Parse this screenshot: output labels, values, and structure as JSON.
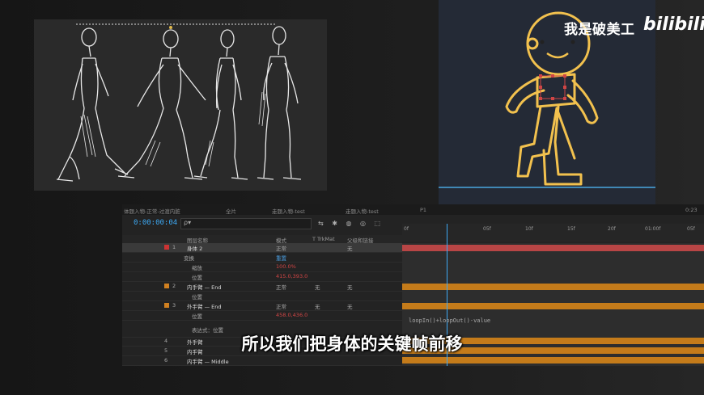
{
  "watermark": {
    "author": "我是破美工",
    "brand": "bilibili"
  },
  "subtitle": "所以我们把身体的关键帧前移",
  "ae": {
    "tabs": [
      "体题入物-正常-过渡内脏",
      "全片",
      "走题入物-test",
      "走题入物-test",
      "P1",
      "0:23"
    ],
    "timecode": "0:00:00:04",
    "search_placeholder": "ρ▾",
    "tools": "⇆ ✱ ◍ ◎ ⬚",
    "col_headers": [
      "图层名称",
      "模式",
      "T TrkMat",
      "父级和链接"
    ],
    "rows": [
      {
        "num": "1",
        "name": "身体 2",
        "mode": "正常",
        "parent": "无"
      },
      {
        "num": "",
        "name": "变换",
        "mode": "重置",
        "parent": ""
      },
      {
        "num": "",
        "name": "缩放",
        "mode": "100.0%",
        "parent": ""
      },
      {
        "num": "",
        "name": "位置",
        "mode": "415.0,393.0",
        "parent": ""
      },
      {
        "num": "2",
        "name": "内手臂 — End",
        "mode": "正常",
        "trkmat": "无",
        "parent": "无"
      },
      {
        "num": "",
        "name": "位置",
        "mode": "",
        "parent": ""
      },
      {
        "num": "3",
        "name": "外手臂 — End",
        "mode": "正常",
        "trkmat": "无",
        "parent": "无"
      },
      {
        "num": "",
        "name": "位置",
        "mode": "458.0,436.0",
        "parent": ""
      },
      {
        "num": "",
        "name": "表达式：位置",
        "mode": "",
        "parent": ""
      },
      {
        "num": "4",
        "name": "外手臂",
        "mode": "",
        "parent": ""
      },
      {
        "num": "5",
        "name": "内手臂",
        "mode": "",
        "parent": ""
      },
      {
        "num": "6",
        "name": "内手臂 — Middle",
        "mode": "",
        "parent": ""
      },
      {
        "num": "7",
        "name": "外手臂",
        "mode": "",
        "parent": ""
      }
    ],
    "ruler_labels": [
      "0f",
      "05f",
      "10f",
      "15f",
      "20f",
      "01:00f",
      "05f"
    ],
    "expression": "loopIn()+loopOut()-value"
  },
  "colors": {
    "accent": "#3da9f4",
    "keyframe_bar": "#c47b1a",
    "layer_bar": "#b84545",
    "character": "#f2c14e"
  }
}
